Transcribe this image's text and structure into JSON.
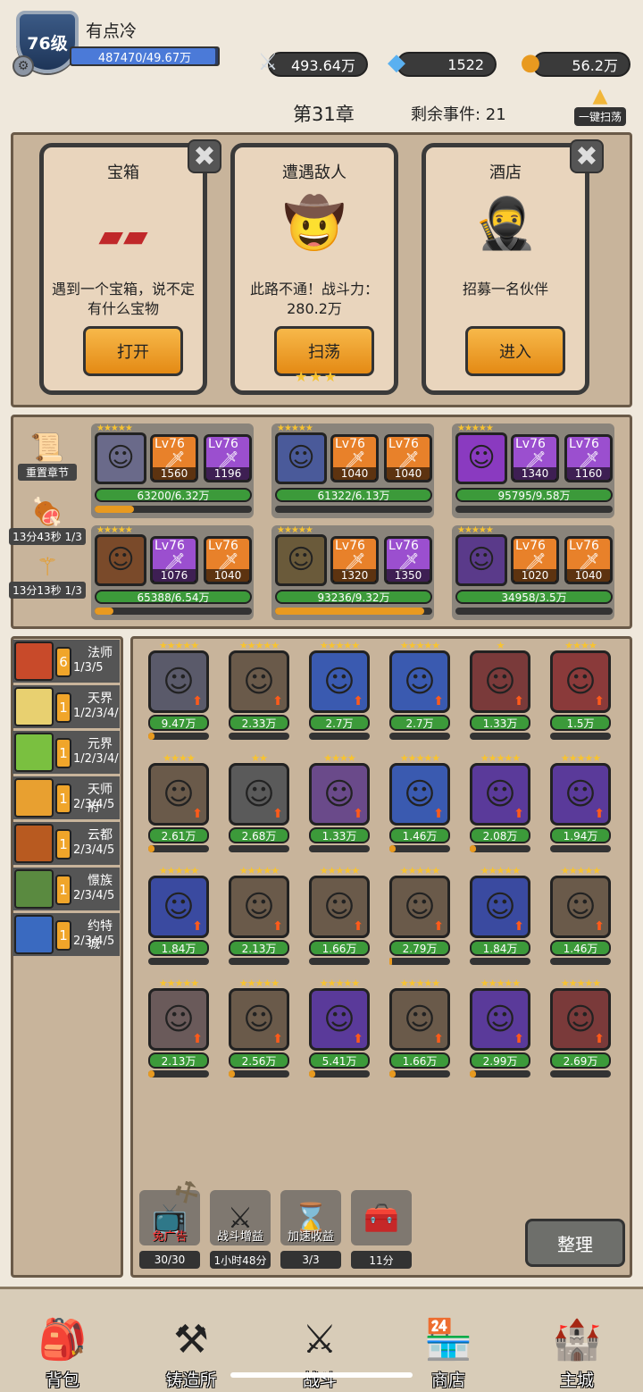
{
  "player": {
    "level": "76级",
    "name": "有点冷",
    "exp": "487470/49.67万",
    "exp_fraction": 0.98
  },
  "resources": {
    "power": "493.64万",
    "gems": "1522",
    "gold": "56.2万"
  },
  "chapter": {
    "title": "第31章",
    "remaining": "剩余事件: 21",
    "sweep_all": "一键扫荡"
  },
  "events": [
    {
      "title": "宝箱",
      "desc": "遇到一个宝箱，说不定有什么宝物",
      "button": "打开"
    },
    {
      "title": "遭遇敌人",
      "desc": "此路不通！战斗力：280.2万",
      "button": "扫荡",
      "stars": "★★★"
    },
    {
      "title": "酒店",
      "desc": "招募一名伙伴",
      "button": "进入"
    }
  ],
  "side_buttons": [
    {
      "label": "重置章节"
    },
    {
      "label": "13分43秒 1/3"
    },
    {
      "label": "13分13秒 1/3"
    }
  ],
  "team": [
    {
      "stars": "★★★★★",
      "weapons": [
        {
          "lv": "Lv76",
          "pw": "1560",
          "color": "#e8812a"
        },
        {
          "lv": "Lv76",
          "pw": "1196",
          "color": "#9b4fcf"
        }
      ],
      "hp": "63200/6.32万",
      "mp": 0.25,
      "color": "#6a6a8a"
    },
    {
      "stars": "★★★★★",
      "weapons": [
        {
          "lv": "Lv76",
          "pw": "1040",
          "color": "#e8812a"
        },
        {
          "lv": "Lv76",
          "pw": "1040",
          "color": "#e8812a"
        }
      ],
      "hp": "61322/6.13万",
      "mp": 0.0,
      "color": "#4a5a9a"
    },
    {
      "stars": "★★★★★",
      "weapons": [
        {
          "lv": "Lv76",
          "pw": "1340",
          "color": "#9b4fcf"
        },
        {
          "lv": "Lv76",
          "pw": "1160",
          "color": "#9b4fcf"
        }
      ],
      "hp": "95795/9.58万",
      "mp": 0.0,
      "color": "#8a3ac0"
    },
    {
      "stars": "★★★★★",
      "weapons": [
        {
          "lv": "Lv76",
          "pw": "1076",
          "color": "#9b4fcf"
        },
        {
          "lv": "Lv76",
          "pw": "1040",
          "color": "#e8812a"
        }
      ],
      "hp": "65388/6.54万",
      "mp": 0.12,
      "color": "#7a4a2a"
    },
    {
      "stars": "★★★★★",
      "weapons": [
        {
          "lv": "Lv76",
          "pw": "1320",
          "color": "#e8812a"
        },
        {
          "lv": "Lv76",
          "pw": "1350",
          "color": "#9b4fcf"
        }
      ],
      "hp": "93236/9.32万",
      "mp": 0.95,
      "color": "#6a5a3a"
    },
    {
      "stars": "★★★★★",
      "weapons": [
        {
          "lv": "Lv76",
          "pw": "1020",
          "color": "#e8812a"
        },
        {
          "lv": "Lv76",
          "pw": "1040",
          "color": "#e8812a"
        }
      ],
      "hp": "34958/3.5万",
      "mp": 0.0,
      "color": "#5a3a8a"
    }
  ],
  "buffs": [
    {
      "name": "法师",
      "count": "6",
      "stages": "1/3/5",
      "icon_color": "#c84a2a"
    },
    {
      "name": "天界",
      "count": "1",
      "stages": "1/2/3/4/",
      "icon_color": "#e8d070"
    },
    {
      "name": "元界",
      "count": "1",
      "stages": "1/2/3/4/",
      "icon_color": "#7ac040"
    },
    {
      "name": "天师府",
      "count": "1",
      "stages": "2/3/4/5",
      "icon_color": "#e8a030"
    },
    {
      "name": "云都",
      "count": "1",
      "stages": "2/3/4/5",
      "icon_color": "#b85a20"
    },
    {
      "name": "憬族",
      "count": "1",
      "stages": "2/3/4/5",
      "icon_color": "#5a8a40"
    },
    {
      "name": "约特城",
      "count": "1",
      "stages": "2/3/4/5",
      "icon_color": "#3a6ac0"
    }
  ],
  "heroes": [
    {
      "power": "9.47万",
      "stars": "★★★★★",
      "color": "#5a5a6a",
      "mp": 0.1
    },
    {
      "power": "2.33万",
      "stars": "★★★★★",
      "color": "#6a5a4a",
      "mp": 0.0
    },
    {
      "power": "2.7万",
      "stars": "★★★★★",
      "color": "#3a5ab0",
      "mp": 0.0
    },
    {
      "power": "2.7万",
      "stars": "★★★★★",
      "color": "#3a5ab0",
      "mp": 0.0
    },
    {
      "power": "1.33万",
      "stars": "★",
      "color": "#7a3a3a",
      "mp": 0.0
    },
    {
      "power": "1.5万",
      "stars": "★★★★",
      "color": "#8a3a3a",
      "mp": 0.0
    },
    {
      "power": "2.61万",
      "stars": "★★★★",
      "color": "#6a5a4a",
      "mp": 0.1
    },
    {
      "power": "2.68万",
      "stars": "★★",
      "color": "#5a5a5a",
      "mp": 0.0
    },
    {
      "power": "1.33万",
      "stars": "★★★★",
      "color": "#6a4a8a",
      "mp": 0.0
    },
    {
      "power": "1.46万",
      "stars": "★★★★★",
      "color": "#3a5ab0",
      "mp": 0.1
    },
    {
      "power": "2.08万",
      "stars": "★★★★★",
      "color": "#5a3a9a",
      "mp": 0.1
    },
    {
      "power": "1.94万",
      "stars": "★★★★★",
      "color": "#5a3a9a",
      "mp": 0.0
    },
    {
      "power": "1.84万",
      "stars": "★★★★★",
      "color": "#3a4aa0",
      "mp": 0.0
    },
    {
      "power": "2.13万",
      "stars": "★★★★★",
      "color": "#6a5a4a",
      "mp": 0.0
    },
    {
      "power": "1.66万",
      "stars": "★★★★★",
      "color": "#6a5a4a",
      "mp": 0.0
    },
    {
      "power": "2.79万",
      "stars": "★★★★★",
      "color": "#6a5a4a",
      "mp": 0.05
    },
    {
      "power": "1.84万",
      "stars": "★★★★★",
      "color": "#3a4aa0",
      "mp": 0.0
    },
    {
      "power": "1.46万",
      "stars": "★★★★★",
      "color": "#6a5a4a",
      "mp": 0.0
    },
    {
      "power": "2.13万",
      "stars": "★★★★★",
      "color": "#6a5a5a",
      "mp": 0.1
    },
    {
      "power": "2.56万",
      "stars": "★★★★★",
      "color": "#6a5a4a",
      "mp": 0.1
    },
    {
      "power": "5.41万",
      "stars": "★★★★★",
      "color": "#5a3a9a",
      "mp": 0.1
    },
    {
      "power": "1.66万",
      "stars": "★★★★★",
      "color": "#6a5a4a",
      "mp": 0.1
    },
    {
      "power": "2.99万",
      "stars": "★★★★★",
      "color": "#5a3a9a",
      "mp": 0.1
    },
    {
      "power": "2.69万",
      "stars": "★★★★★",
      "color": "#7a3a3a",
      "mp": 0.0
    }
  ],
  "tools": [
    {
      "label": "30/30",
      "overlay": "免广告",
      "icon": "tv-icon"
    },
    {
      "label": "1小时48分",
      "overlay": "战斗增益",
      "icon": "sword-icon"
    },
    {
      "label": "3/3",
      "overlay": "加速收益",
      "icon": "hourglass-icon"
    },
    {
      "label": "11分",
      "overlay": "",
      "icon": "chest-icon"
    }
  ],
  "tidy_button": "整理",
  "nav": [
    {
      "label": "背包",
      "icon": "bag-icon"
    },
    {
      "label": "铸造所",
      "icon": "anvil-icon"
    },
    {
      "label": "战斗",
      "icon": "crossed-swords-icon"
    },
    {
      "label": "商店",
      "icon": "shop-icon"
    },
    {
      "label": "主城",
      "icon": "castle-icon"
    }
  ]
}
